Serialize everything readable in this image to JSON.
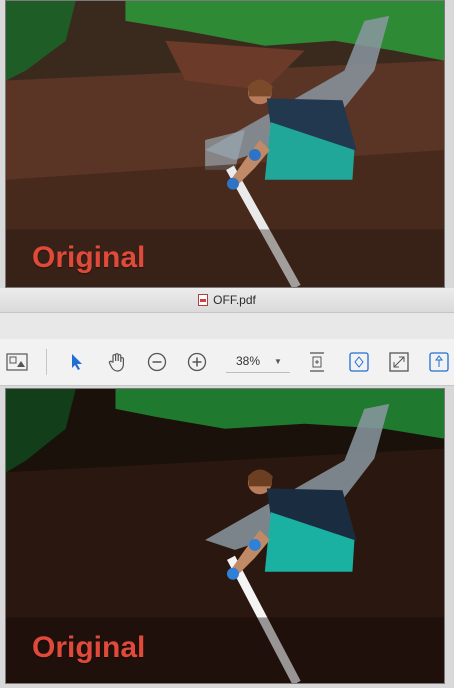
{
  "top_image": {
    "overlay_text": "Original"
  },
  "window": {
    "title": "OFF.pdf"
  },
  "toolbar": {
    "zoom_value": "38%",
    "icons": [
      "sidebar-thumbnails-icon",
      "select-arrow-icon",
      "hand-tool-icon",
      "zoom-out-icon",
      "zoom-in-icon",
      "fit-page-icon",
      "rotate-icon",
      "fullscreen-icon",
      "share-icon"
    ]
  },
  "bottom_image": {
    "overlay_text": "Original"
  },
  "colors": {
    "overlay_text": "#e04a3a",
    "accent_blue": "#1f6fd6"
  }
}
